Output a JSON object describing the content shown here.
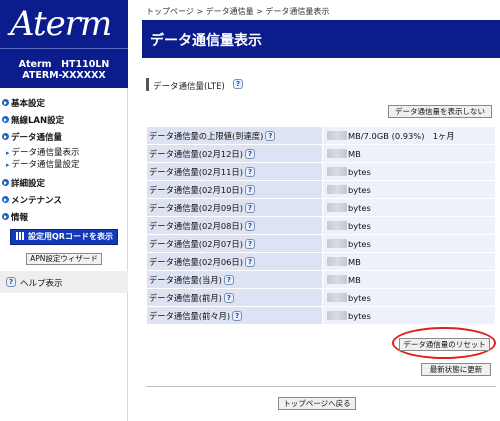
{
  "sidebar": {
    "logo": "Aterm",
    "model_line1": "Aterm　HT110LN",
    "model_line2": "ATERM-XXXXXX",
    "nav": [
      {
        "label": "基本設定"
      },
      {
        "label": "無線LAN設定"
      },
      {
        "label": "データ通信量"
      },
      {
        "label": "詳細設定"
      },
      {
        "label": "メンテナンス"
      },
      {
        "label": "情報"
      }
    ],
    "subnav": [
      {
        "label": "データ通信量表示"
      },
      {
        "label": "データ通信量設定"
      }
    ],
    "qr_button": "設定用QRコードを表示",
    "apn_button": "APN設定ウィザード",
    "help": "ヘルプ表示"
  },
  "main": {
    "breadcrumb": "トップページ > データ通信量 > データ通信量表示",
    "title": "データ通信量表示",
    "section_title": "データ通信量(LTE)",
    "hide_button": "データ通信量を表示しない",
    "rows": [
      {
        "key": "データ通信量の上限値(到達度)",
        "value": "MB/7.0GB (0.93%)　1ヶ月"
      },
      {
        "key": "データ通信量(02月12日)",
        "value": "MB"
      },
      {
        "key": "データ通信量(02月11日)",
        "value": "bytes"
      },
      {
        "key": "データ通信量(02月10日)",
        "value": "bytes"
      },
      {
        "key": "データ通信量(02月09日)",
        "value": "bytes"
      },
      {
        "key": "データ通信量(02月08日)",
        "value": "bytes"
      },
      {
        "key": "データ通信量(02月07日)",
        "value": "bytes"
      },
      {
        "key": "データ通信量(02月06日)",
        "value": "MB"
      },
      {
        "key": "データ通信量(当月)",
        "value": "MB"
      },
      {
        "key": "データ通信量(前月)",
        "value": "bytes"
      },
      {
        "key": "データ通信量(前々月)",
        "value": "bytes"
      }
    ],
    "reset_button": "データ通信量のリセット",
    "refresh_button": "最新状態に更新",
    "top_button": "トップページへ戻る"
  },
  "icons": {
    "help": "question-icon",
    "qr": "qr-code-icon",
    "nav_bullet": "arrow-bullet-icon"
  },
  "colors": {
    "brand_navy": "#0b1c8c",
    "qr_button": "#1438b8",
    "highlight_red": "#e0201a",
    "table_key_bg": "#dde3f3",
    "table_value_bg": "#eef1fa"
  }
}
